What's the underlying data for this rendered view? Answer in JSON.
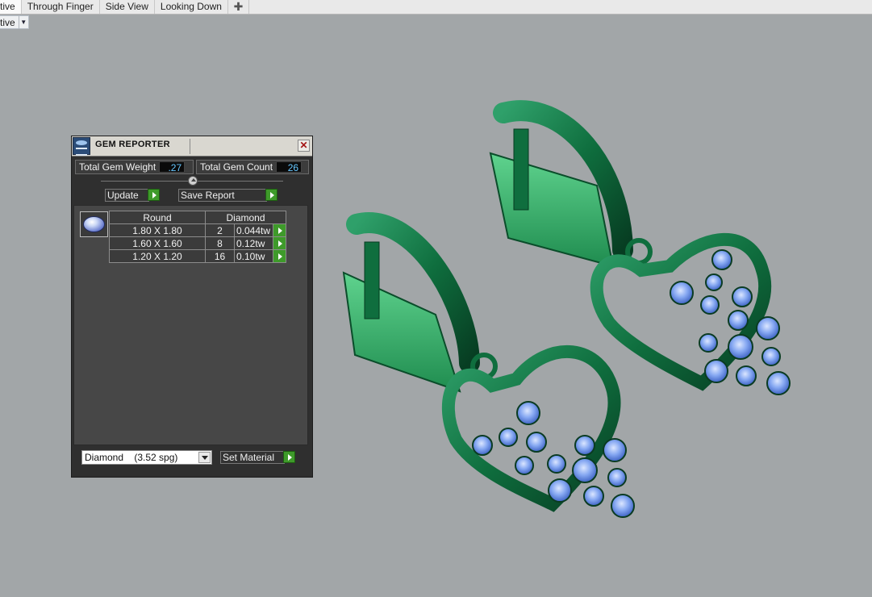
{
  "tabs": [
    {
      "label": "tive",
      "active": true
    },
    {
      "label": "Through Finger",
      "active": false
    },
    {
      "label": "Side View",
      "active": false
    },
    {
      "label": "Looking Down",
      "active": false
    }
  ],
  "add_tab_glyph": "✚",
  "view_selector": {
    "value": "tive"
  },
  "gem_reporter": {
    "title": "GEM REPORTER",
    "close_glyph": "✕",
    "total_weight_label": "Total Gem Weight",
    "total_weight_value": ".27",
    "total_count_label": "Total Gem Count",
    "total_count_value": "26",
    "update_label": "Update",
    "save_report_label": "Save Report",
    "table": {
      "header_shape": "Round",
      "header_material": "Diamond",
      "rows": [
        {
          "size": "1.80 X 1.80",
          "count": "2",
          "weight": "0.044tw"
        },
        {
          "size": "1.60 X 1.60",
          "count": "8",
          "weight": "0.12tw"
        },
        {
          "size": "1.20 X 1.20",
          "count": "16",
          "weight": "0.10tw"
        }
      ]
    },
    "material": {
      "name": "Diamond",
      "spg": "(3.52 spg)"
    },
    "set_material_label": "Set Material"
  },
  "colors": {
    "viewport_bg": "#a2a6a8",
    "metal_green": "#0f6e3e",
    "gem_blue": "#7aa3f0",
    "accent_green_button": "#3e9a2a",
    "value_text": "#66c7ff"
  }
}
